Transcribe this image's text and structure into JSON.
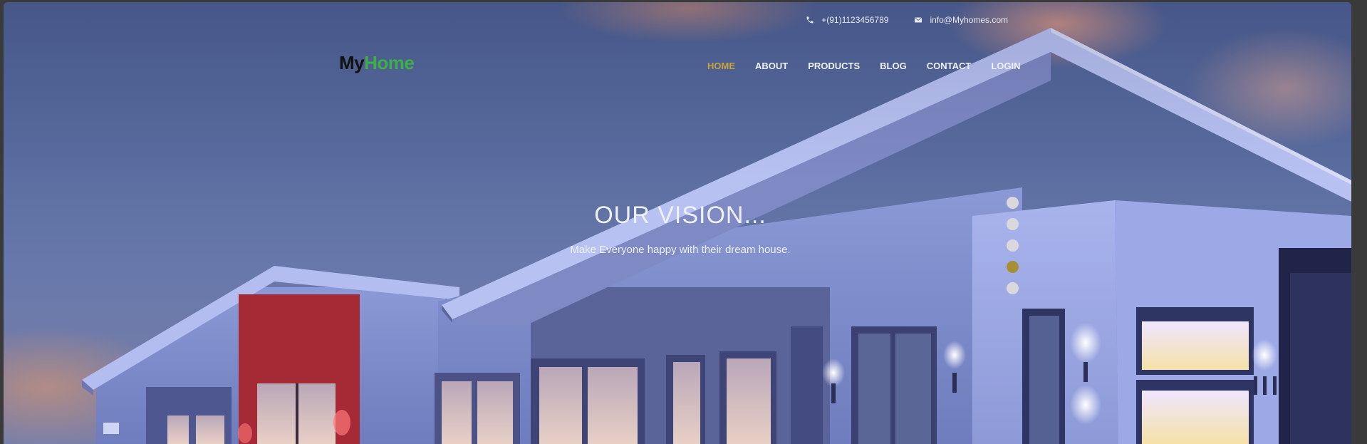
{
  "topbar": {
    "phone": "+(91)1123456789",
    "email": "info@Myhomes.com",
    "phone_icon": "phone-icon",
    "email_icon": "envelope-icon"
  },
  "logo": {
    "part1": "My",
    "part2": "Home"
  },
  "nav": {
    "items": [
      {
        "label": "HOME",
        "active": true
      },
      {
        "label": "ABOUT",
        "active": false
      },
      {
        "label": "PRODUCTS",
        "active": false
      },
      {
        "label": "BLOG",
        "active": false
      },
      {
        "label": "CONTACT",
        "active": false
      },
      {
        "label": "LOGIN",
        "active": false
      }
    ]
  },
  "slider": {
    "title": "OUR VISION...",
    "subtitle": "Make Everyone happy with their dream house.",
    "slide_count": 5,
    "active_slide": 4
  },
  "colors": {
    "accent": "#c9a33a",
    "dot_active": "#a88f36",
    "logo_green": "#3fae4a",
    "logo_dark": "#111111"
  }
}
